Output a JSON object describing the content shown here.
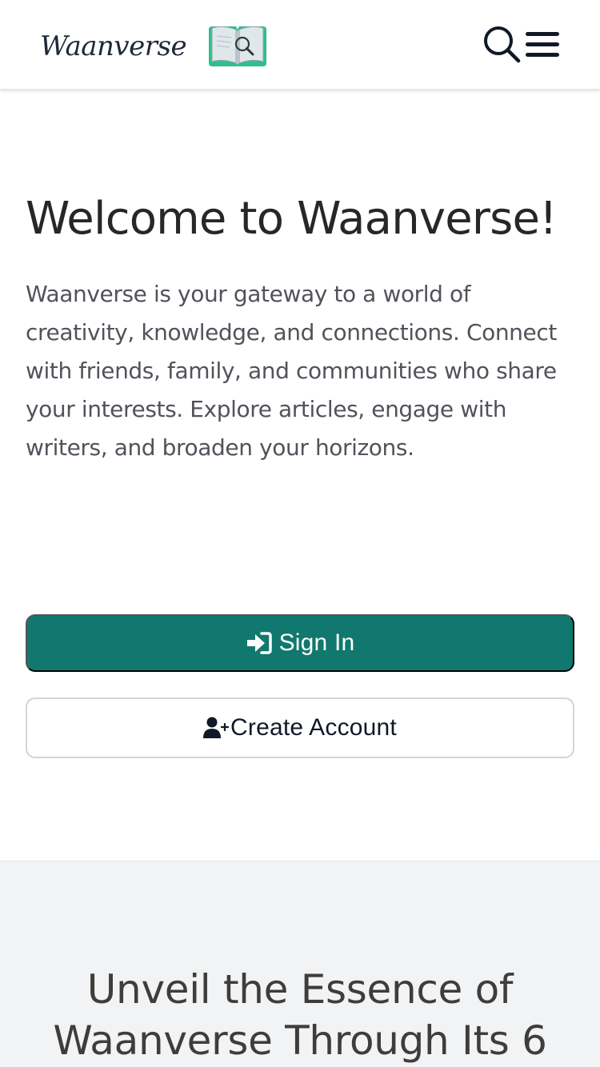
{
  "brand": {
    "name": "Waanverse"
  },
  "header": {
    "icons": {
      "search": "search-icon",
      "menu": "hamburger-menu-icon",
      "logo": "book-magnifier-logo"
    }
  },
  "hero": {
    "title": "Welcome to Waanverse!",
    "text": "Waanverse is your gateway to a world of creativity, knowledge, and connections. Connect with friends, family, and communities who share your interests. Explore articles, engage with writers, and broaden your horizons."
  },
  "actions": {
    "sign_in": "Sign In",
    "sign_in_icon": "sign-in-arrow-icon",
    "create_account": "Create Account",
    "create_account_icon": "user-plus-icon"
  },
  "section": {
    "title": "Unveil the Essence of Waanverse Through Its 6"
  },
  "colors": {
    "primary": "#10786e",
    "logo_green": "#2fbf8c",
    "section_bg": "#f2f3f5",
    "text_dark": "#27272a",
    "text_muted": "#52525b"
  }
}
